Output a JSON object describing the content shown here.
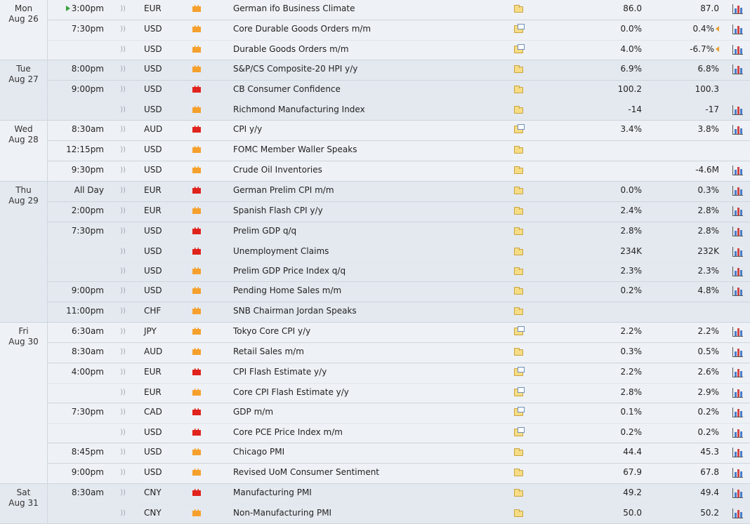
{
  "days": [
    {
      "dow": "Mon",
      "date": "Aug 26",
      "groups": [
        {
          "time": "3:00pm",
          "upcoming": true,
          "events": [
            {
              "cur": "EUR",
              "imp": "med",
              "name": "German ifo Business Climate",
              "icon": "folder",
              "fc": "86.0",
              "pv": "87.0",
              "graph": true
            }
          ]
        },
        {
          "time": "7:30pm",
          "events": [
            {
              "cur": "USD",
              "imp": "med",
              "name": "Core Durable Goods Orders m/m",
              "icon": "doc",
              "fc": "0.0%",
              "pv": "0.4%",
              "rev": true,
              "graph": true
            },
            {
              "cur": "USD",
              "imp": "med",
              "name": "Durable Goods Orders m/m",
              "icon": "doc",
              "fc": "4.0%",
              "pv": "-6.7%",
              "rev": true,
              "graph": true
            }
          ]
        }
      ]
    },
    {
      "dow": "Tue",
      "date": "Aug 27",
      "groups": [
        {
          "time": "8:00pm",
          "events": [
            {
              "cur": "USD",
              "imp": "med",
              "name": "S&P/CS Composite-20 HPI y/y",
              "icon": "folder",
              "fc": "6.9%",
              "pv": "6.8%",
              "graph": true
            }
          ]
        },
        {
          "time": "9:00pm",
          "events": [
            {
              "cur": "USD",
              "imp": "high",
              "name": "CB Consumer Confidence",
              "icon": "folder",
              "fc": "100.2",
              "pv": "100.3",
              "graph": false
            },
            {
              "cur": "USD",
              "imp": "med",
              "name": "Richmond Manufacturing Index",
              "icon": "folder",
              "fc": "-14",
              "pv": "-17",
              "graph": true
            }
          ]
        }
      ]
    },
    {
      "dow": "Wed",
      "date": "Aug 28",
      "groups": [
        {
          "time": "8:30am",
          "events": [
            {
              "cur": "AUD",
              "imp": "high",
              "name": "CPI y/y",
              "icon": "doc",
              "fc": "3.4%",
              "pv": "3.8%",
              "graph": true
            }
          ]
        },
        {
          "time": "12:15pm",
          "events": [
            {
              "cur": "USD",
              "imp": "med",
              "name": "FOMC Member Waller Speaks",
              "icon": "folder",
              "fc": "",
              "pv": "",
              "graph": false
            }
          ]
        },
        {
          "time": "9:30pm",
          "events": [
            {
              "cur": "USD",
              "imp": "med",
              "name": "Crude Oil Inventories",
              "icon": "folder",
              "fc": "",
              "pv": "-4.6M",
              "graph": true
            }
          ]
        }
      ]
    },
    {
      "dow": "Thu",
      "date": "Aug 29",
      "groups": [
        {
          "time": "All Day",
          "events": [
            {
              "cur": "EUR",
              "imp": "high",
              "name": "German Prelim CPI m/m",
              "icon": "folder",
              "fc": "0.0%",
              "pv": "0.3%",
              "graph": true
            }
          ]
        },
        {
          "time": "2:00pm",
          "events": [
            {
              "cur": "EUR",
              "imp": "med",
              "name": "Spanish Flash CPI y/y",
              "icon": "folder",
              "fc": "2.4%",
              "pv": "2.8%",
              "graph": true
            }
          ]
        },
        {
          "time": "7:30pm",
          "events": [
            {
              "cur": "USD",
              "imp": "high",
              "name": "Prelim GDP q/q",
              "icon": "folder",
              "fc": "2.8%",
              "pv": "2.8%",
              "graph": true
            },
            {
              "cur": "USD",
              "imp": "high",
              "name": "Unemployment Claims",
              "icon": "folder",
              "fc": "234K",
              "pv": "232K",
              "graph": true
            },
            {
              "cur": "USD",
              "imp": "med",
              "name": "Prelim GDP Price Index q/q",
              "icon": "folder",
              "fc": "2.3%",
              "pv": "2.3%",
              "graph": true
            }
          ]
        },
        {
          "time": "9:00pm",
          "events": [
            {
              "cur": "USD",
              "imp": "med",
              "name": "Pending Home Sales m/m",
              "icon": "folder",
              "fc": "0.2%",
              "pv": "4.8%",
              "graph": true
            }
          ]
        },
        {
          "time": "11:00pm",
          "events": [
            {
              "cur": "CHF",
              "imp": "med",
              "name": "SNB Chairman Jordan Speaks",
              "icon": "folder",
              "fc": "",
              "pv": "",
              "graph": false
            }
          ]
        }
      ]
    },
    {
      "dow": "Fri",
      "date": "Aug 30",
      "groups": [
        {
          "time": "6:30am",
          "events": [
            {
              "cur": "JPY",
              "imp": "med",
              "name": "Tokyo Core CPI y/y",
              "icon": "doc",
              "fc": "2.2%",
              "pv": "2.2%",
              "graph": true
            }
          ]
        },
        {
          "time": "8:30am",
          "events": [
            {
              "cur": "AUD",
              "imp": "med",
              "name": "Retail Sales m/m",
              "icon": "folder",
              "fc": "0.3%",
              "pv": "0.5%",
              "graph": true
            }
          ]
        },
        {
          "time": "4:00pm",
          "events": [
            {
              "cur": "EUR",
              "imp": "high",
              "name": "CPI Flash Estimate y/y",
              "icon": "doc",
              "fc": "2.2%",
              "pv": "2.6%",
              "graph": true
            },
            {
              "cur": "EUR",
              "imp": "med",
              "name": "Core CPI Flash Estimate y/y",
              "icon": "doc",
              "fc": "2.8%",
              "pv": "2.9%",
              "graph": true
            }
          ]
        },
        {
          "time": "7:30pm",
          "events": [
            {
              "cur": "CAD",
              "imp": "high",
              "name": "GDP m/m",
              "icon": "doc",
              "fc": "0.1%",
              "pv": "0.2%",
              "graph": true
            },
            {
              "cur": "USD",
              "imp": "high",
              "name": "Core PCE Price Index m/m",
              "icon": "doc",
              "fc": "0.2%",
              "pv": "0.2%",
              "graph": true
            }
          ]
        },
        {
          "time": "8:45pm",
          "events": [
            {
              "cur": "USD",
              "imp": "med",
              "name": "Chicago PMI",
              "icon": "folder",
              "fc": "44.4",
              "pv": "45.3",
              "graph": true
            }
          ]
        },
        {
          "time": "9:00pm",
          "events": [
            {
              "cur": "USD",
              "imp": "med",
              "name": "Revised UoM Consumer Sentiment",
              "icon": "folder",
              "fc": "67.9",
              "pv": "67.8",
              "graph": true
            }
          ]
        }
      ]
    },
    {
      "dow": "Sat",
      "date": "Aug 31",
      "groups": [
        {
          "time": "8:30am",
          "events": [
            {
              "cur": "CNY",
              "imp": "high",
              "name": "Manufacturing PMI",
              "icon": "folder",
              "fc": "49.2",
              "pv": "49.4",
              "graph": true
            },
            {
              "cur": "CNY",
              "imp": "med",
              "name": "Non-Manufacturing PMI",
              "icon": "folder",
              "fc": "50.0",
              "pv": "50.2",
              "graph": true
            }
          ]
        }
      ]
    }
  ]
}
